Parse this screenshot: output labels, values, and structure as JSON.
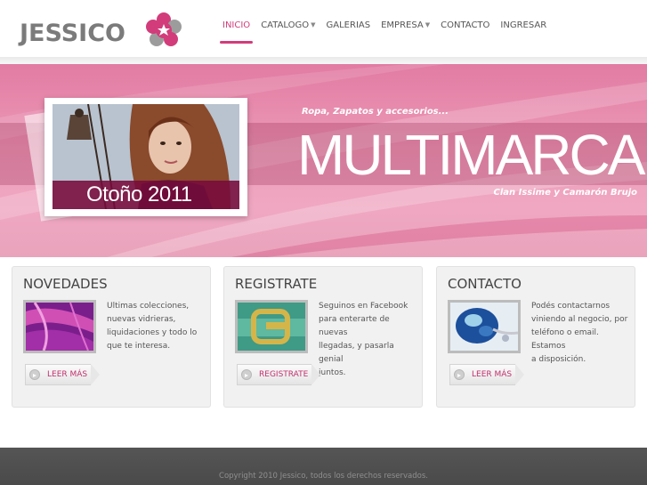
{
  "brand": {
    "logo_text": "JESSICO",
    "accent": "#d23c7a"
  },
  "nav": {
    "items": [
      {
        "label": "INICIO",
        "active": true,
        "dropdown": false
      },
      {
        "label": "CATALOGO",
        "active": false,
        "dropdown": true
      },
      {
        "label": "GALERIAS",
        "active": false,
        "dropdown": false
      },
      {
        "label": "EMPRESA",
        "active": false,
        "dropdown": true
      },
      {
        "label": "CONTACTO",
        "active": false,
        "dropdown": false
      },
      {
        "label": "INGRESAR",
        "active": false,
        "dropdown": false
      }
    ],
    "dropdown_icon": "caret-down-icon"
  },
  "banner": {
    "tagline": "Ropa, Zapatos y accesorios...",
    "title": "MULTIMARCA",
    "subline": "Clan Issime y Camarón Brujo",
    "photo_caption": "Otoño 2011",
    "background_color": "#e88aae"
  },
  "boxes": [
    {
      "title": "NOVEDADES",
      "lines": [
        "Ultimas colecciones,",
        "nuevas vidrieras,",
        "liquidaciones y todo lo",
        "que te interesa."
      ],
      "button": "LEER MÁS",
      "thumb_colors": [
        "#7a1e8c",
        "#d04fb5"
      ]
    },
    {
      "title": "REGISTRATE",
      "lines": [
        "Seguinos en Facebook",
        "para enterarte de nuevas",
        "llegadas, y pasarla genial",
        "juntos."
      ],
      "button": "REGISTRATE",
      "thumb_colors": [
        "#3f9a86",
        "#d4b54a"
      ]
    },
    {
      "title": "CONTACTO",
      "lines": [
        "Podés contactarnos",
        "viniendo al negocio, por",
        "teléfono o email. Estamos",
        "a disposición."
      ],
      "button": "LEER MÁS",
      "thumb_colors": [
        "#1c4f9c",
        "#9fd2ea"
      ]
    }
  ],
  "footer": {
    "copyright": "Copyright 2010 Jessico, todos los derechos reservados."
  }
}
